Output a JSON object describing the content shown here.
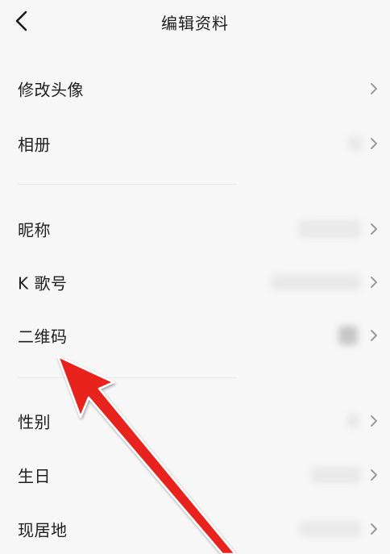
{
  "header": {
    "title": "编辑资料",
    "back_icon": "chevron-left-icon"
  },
  "sections": [
    {
      "items": [
        {
          "label": "修改头像"
        },
        {
          "label": "相册"
        }
      ]
    },
    {
      "items": [
        {
          "label": "昵称"
        },
        {
          "label": "K 歌号"
        },
        {
          "label": "二维码"
        }
      ]
    },
    {
      "items": [
        {
          "label": "性别"
        },
        {
          "label": "生日"
        },
        {
          "label": "现居地"
        }
      ]
    }
  ],
  "colors": {
    "background": "#f7f7f7",
    "annotation_arrow": "#e8211f",
    "chevron": "#9a9a9a"
  }
}
